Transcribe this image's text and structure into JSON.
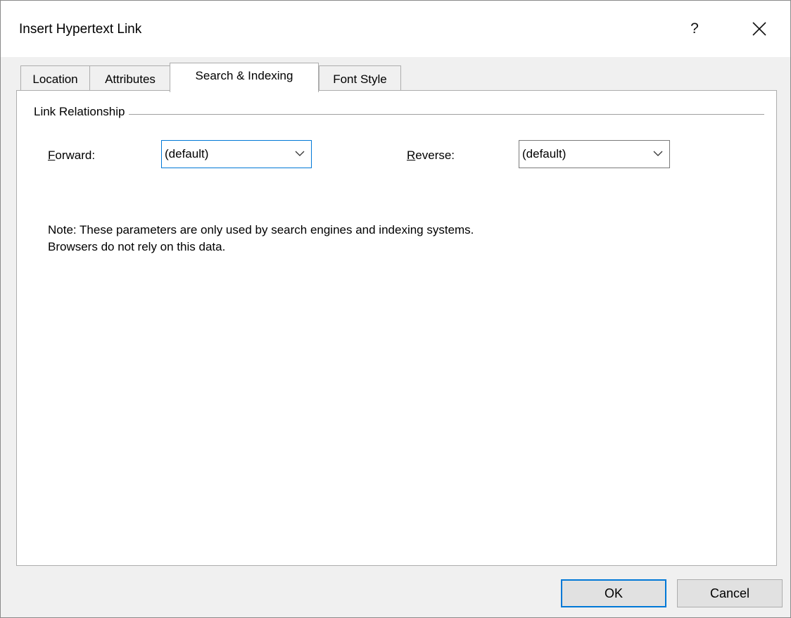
{
  "window": {
    "title": "Insert Hypertext Link",
    "help_label": "?",
    "close_label": "✕"
  },
  "tabs": [
    {
      "label": "Location",
      "active": false
    },
    {
      "label": "Attributes",
      "active": false
    },
    {
      "label": "Search & Indexing",
      "active": true
    },
    {
      "label": "Font Style",
      "active": false
    }
  ],
  "group": {
    "label": "Link Relationship"
  },
  "forward": {
    "label_accel": "F",
    "label_rest": "orward:",
    "value": "(default)"
  },
  "reverse": {
    "label_accel": "R",
    "label_rest": "everse:",
    "value": "(default)"
  },
  "note": {
    "line1": "Note: These parameters are only used by search engines and indexing systems.",
    "line2": "Browsers do not rely on this data."
  },
  "buttons": {
    "ok": "OK",
    "cancel": "Cancel"
  },
  "colors": {
    "focus_accent": "#0078d7",
    "button_face": "#e1e1e1",
    "dialog_bg": "#f0f0f0"
  }
}
